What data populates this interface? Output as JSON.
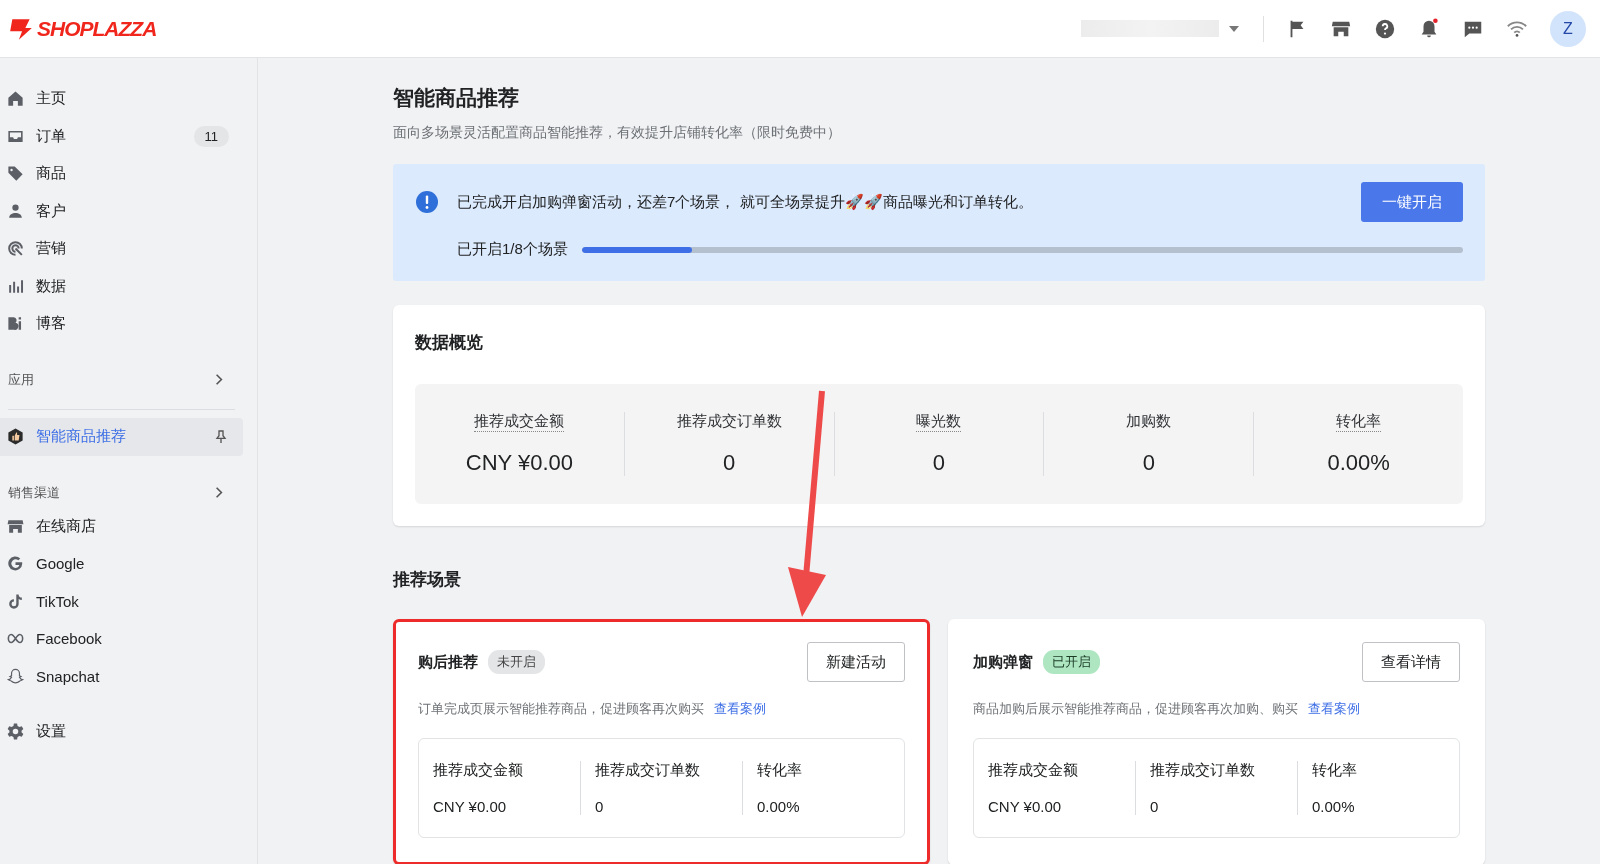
{
  "header": {
    "logo": "SHOPLAZZA",
    "avatar": "Z",
    "notification_dot": true
  },
  "sidebar": {
    "items": [
      {
        "label": "主页",
        "selected": false
      },
      {
        "label": "订单",
        "badge": "11",
        "selected": false
      },
      {
        "label": "商品",
        "selected": false
      },
      {
        "label": "客户",
        "selected": false
      },
      {
        "label": "营销",
        "selected": false
      },
      {
        "label": "数据",
        "selected": false
      },
      {
        "label": "博客",
        "selected": false
      }
    ],
    "apps_section": "应用",
    "apps": [
      {
        "label": "智能商品推荐",
        "selected": true
      }
    ],
    "channels_section": "销售渠道",
    "channels": [
      {
        "label": "在线商店",
        "selected": false
      },
      {
        "label": "Google",
        "selected": false
      },
      {
        "label": "TikTok",
        "selected": false
      },
      {
        "label": "Facebook",
        "selected": false
      },
      {
        "label": "Snapchat",
        "selected": false
      }
    ],
    "settings": {
      "label": "设置",
      "selected": false
    }
  },
  "page": {
    "title": "智能商品推荐",
    "subtitle": "面向多场景灵活配置商品智能推荐，有效提升店铺转化率（限时免费中）",
    "banner": {
      "message": "已完成开启加购弹窗活动，还差7个场景， 就可全场景提升🚀🚀商品曝光和订单转化。",
      "button": "一键开启",
      "progress_label": "已开启1/8个场景",
      "level": 0.125
    },
    "overview": {
      "title": "数据概览",
      "metrics": [
        {
          "label": "推荐成交金额",
          "value": "CNY ¥0.00",
          "dotted": true
        },
        {
          "label": "推荐成交订单数",
          "value": "0",
          "dotted": false
        },
        {
          "label": "曝光数",
          "value": "0",
          "dotted": true
        },
        {
          "label": "加购数",
          "value": "0",
          "dotted": false
        },
        {
          "label": "转化率",
          "value": "0.00%",
          "dotted": true
        }
      ]
    },
    "scenes_title": "推荐场景",
    "scenes": [
      {
        "title": "购后推荐",
        "status": "未开启",
        "enabled": false,
        "button": "新建活动",
        "description": "订单完成页展示智能推荐商品，促进顾客再次购买",
        "link": "查看案例",
        "highlighted": true,
        "metrics": [
          {
            "label": "推荐成交金额",
            "value": "CNY ¥0.00"
          },
          {
            "label": "推荐成交订单数",
            "value": "0"
          },
          {
            "label": "转化率",
            "value": "0.00%"
          }
        ]
      },
      {
        "title": "加购弹窗",
        "status": "已开启",
        "enabled": true,
        "button": "查看详情",
        "description": "商品加购后展示智能推荐商品，促进顾客再次加购、购买",
        "link": "查看案例",
        "highlighted": false,
        "metrics": [
          {
            "label": "推荐成交金额",
            "value": "CNY ¥0.00"
          },
          {
            "label": "推荐成交订单数",
            "value": "0"
          },
          {
            "label": "转化率",
            "value": "0.00%"
          }
        ]
      }
    ]
  }
}
